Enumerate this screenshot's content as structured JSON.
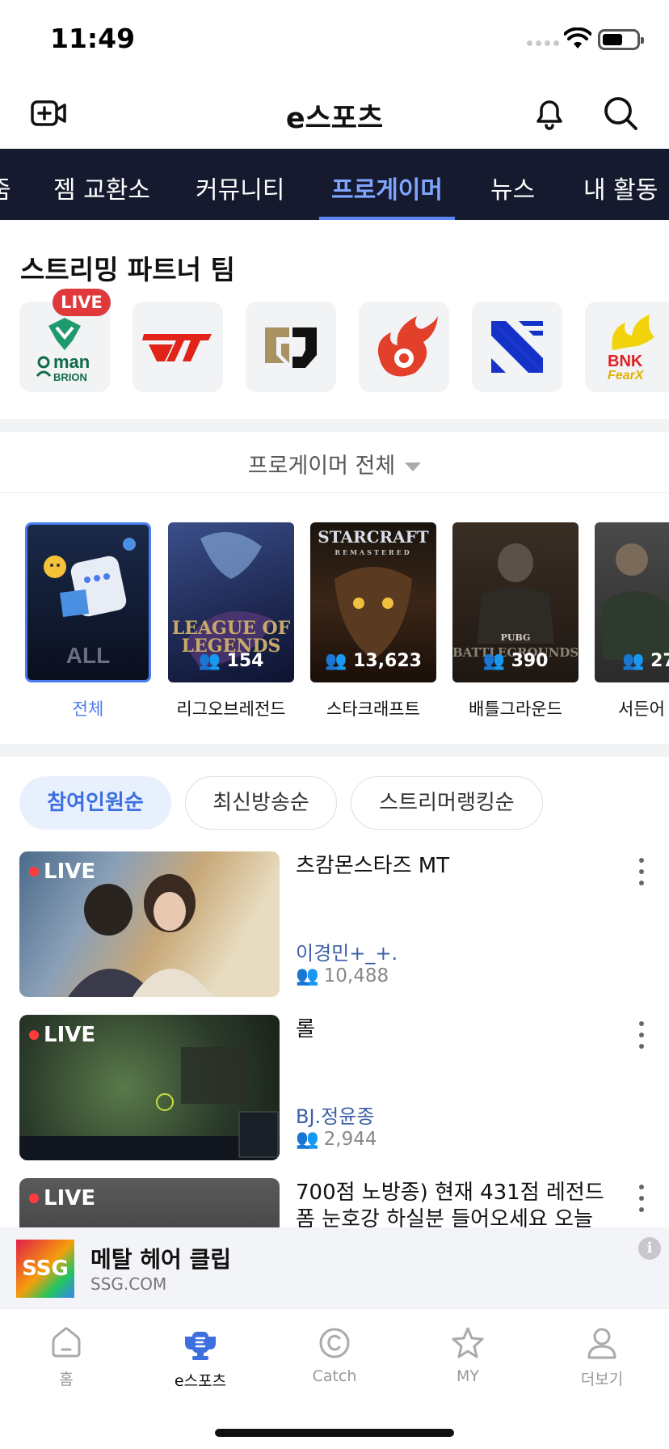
{
  "status_bar": {
    "time": "11:49"
  },
  "header": {
    "title": "e스포츠"
  },
  "categories": [
    {
      "label": "줌"
    },
    {
      "label": "젬 교환소"
    },
    {
      "label": "커뮤니티"
    },
    {
      "label": "프로게이머",
      "active": true
    },
    {
      "label": "뉴스"
    },
    {
      "label": "내 활동"
    }
  ],
  "partners": {
    "title": "스트리밍 파트너 팀",
    "live_badge": "LIVE",
    "teams": [
      {
        "icon": "oman-brion-logo",
        "logo_lines": [
          "man",
          "BRION"
        ]
      },
      {
        "icon": "t1-logo"
      },
      {
        "icon": "gen-g-logo"
      },
      {
        "icon": "flame-logo"
      },
      {
        "icon": "x-logo"
      },
      {
        "icon": "bnk-fearx-logo",
        "logo_lines": [
          "BNK",
          "FearX"
        ]
      }
    ]
  },
  "filter": {
    "label": "프로게이머 전체"
  },
  "games": [
    {
      "name": "전체",
      "art": "ALL",
      "selected": true
    },
    {
      "name": "리그오브레전드",
      "art": [
        "LEAGUE OF",
        "LEGENDS"
      ],
      "viewers": "154"
    },
    {
      "name": "스타크래프트",
      "art": [
        "STARCRAFT",
        "REMASTERED"
      ],
      "viewers": "13,623"
    },
    {
      "name": "배틀그라운드",
      "art": [
        "PUBG",
        "BATTLEGROUNDS"
      ],
      "viewers": "390"
    },
    {
      "name": "서든어",
      "viewers": "27"
    }
  ],
  "sort": [
    {
      "label": "참여인원순",
      "active": true
    },
    {
      "label": "최신방송순"
    },
    {
      "label": "스트리머랭킹순"
    }
  ],
  "streams": [
    {
      "live": "LIVE",
      "title": "츠캄몬스타즈 MT",
      "user": "이경민+_+.",
      "viewers": "10,488"
    },
    {
      "live": "LIVE",
      "title": "롤",
      "user": "BJ.정윤종",
      "viewers": "2,944"
    },
    {
      "live": "LIVE",
      "title": "700점 노방종) 현재 431점 레전드 폼 눈호강 하실분 들어오세요 오늘"
    }
  ],
  "ad": {
    "logo": "SSG",
    "title": "메탈 헤어 클립",
    "sub": "SSG.COM",
    "info": "i"
  },
  "bottom_nav": [
    {
      "label": "홈",
      "icon": "home-icon"
    },
    {
      "label": "e스포츠",
      "icon": "esports-icon",
      "active": true
    },
    {
      "label": "Catch",
      "icon": "catch-icon"
    },
    {
      "label": "MY",
      "icon": "star-icon"
    },
    {
      "label": "더보기",
      "icon": "person-icon"
    }
  ],
  "colors": {
    "accent": "#4a7cf0",
    "nav_bg": "#161a2e",
    "live": "#e0393b"
  }
}
